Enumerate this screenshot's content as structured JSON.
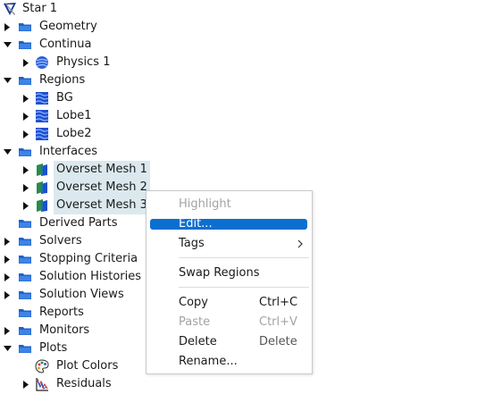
{
  "tree": {
    "root": "Star 1",
    "geometry": "Geometry",
    "continua": "Continua",
    "physics1": "Physics 1",
    "regions": "Regions",
    "bg": "BG",
    "lobe1": "Lobe1",
    "lobe2": "Lobe2",
    "interfaces": "Interfaces",
    "overset1": "Overset Mesh 1",
    "overset2": "Overset Mesh 2",
    "overset3": "Overset Mesh 3",
    "derived_parts": "Derived Parts",
    "solvers": "Solvers",
    "stopping_criteria": "Stopping Criteria",
    "solution_histories": "Solution Histories",
    "solution_views": "Solution Views",
    "reports": "Reports",
    "monitors": "Monitors",
    "plots": "Plots",
    "plot_colors": "Plot Colors",
    "residuals": "Residuals"
  },
  "context_menu": {
    "highlight": "Highlight",
    "edit": "Edit...",
    "tags": "Tags",
    "swap_regions": "Swap Regions",
    "copy": "Copy",
    "copy_shortcut": "Ctrl+C",
    "paste": "Paste",
    "paste_shortcut": "Ctrl+V",
    "delete": "Delete",
    "delete_shortcut": "Delete",
    "rename": "Rename..."
  },
  "colors": {
    "folder_blue": "#1f62c9",
    "selection_bg": "#dbe9ef",
    "menu_highlight": "#0b6fd0",
    "disabled_text": "#a3a3a3"
  }
}
